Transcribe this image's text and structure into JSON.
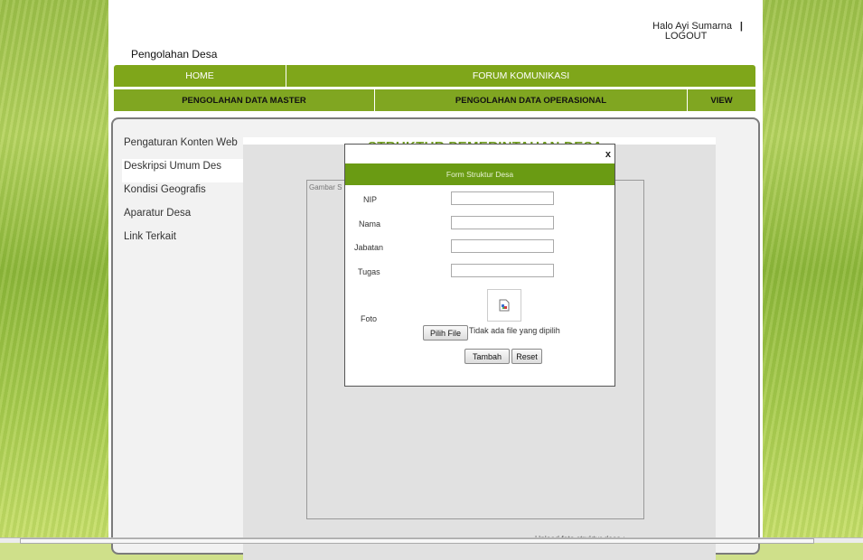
{
  "header": {
    "greeting": "Halo Ayi Sumarna",
    "separator": "|",
    "logout": "LOGOUT",
    "site_title": "Pengolahan Desa"
  },
  "nav_primary": {
    "home": "HOME",
    "forum": "FORUM KOMUNIKASI"
  },
  "nav_secondary": {
    "master": "PENGOLAHAN DATA MASTER",
    "operasional": "PENGOLAHAN DATA OPERASIONAL",
    "view": "VIEW"
  },
  "sidebar": {
    "items": [
      {
        "label": "Pengaturan Konten Web"
      },
      {
        "label": "Deskripsi Umum Des"
      },
      {
        "label": "Kondisi Geografis"
      },
      {
        "label": "Aparatur Desa"
      },
      {
        "label": "Link Terkait"
      }
    ]
  },
  "main": {
    "title": "STRUKTUR PEMERINTAHAN DESA",
    "photo_label": "Gambar S",
    "upload_label": "Upload foto struktur desa :"
  },
  "modal": {
    "close": "x",
    "title": "Form Struktur Desa",
    "fields": {
      "nip": {
        "label": "NIP",
        "value": ""
      },
      "nama": {
        "label": "Nama",
        "value": ""
      },
      "jabatan": {
        "label": "Jabatan",
        "value": ""
      },
      "tugas": {
        "label": "Tugas",
        "value": ""
      },
      "foto": {
        "label": "Foto"
      }
    },
    "file_button": "Pilih File",
    "no_file_text": "Tidak ada file yang dipilih",
    "submit": "Tambah",
    "reset": "Reset"
  },
  "colors": {
    "nav_green": "#7fa61a",
    "modal_header": "#6a9b13",
    "title_green": "#6e9a1e"
  }
}
